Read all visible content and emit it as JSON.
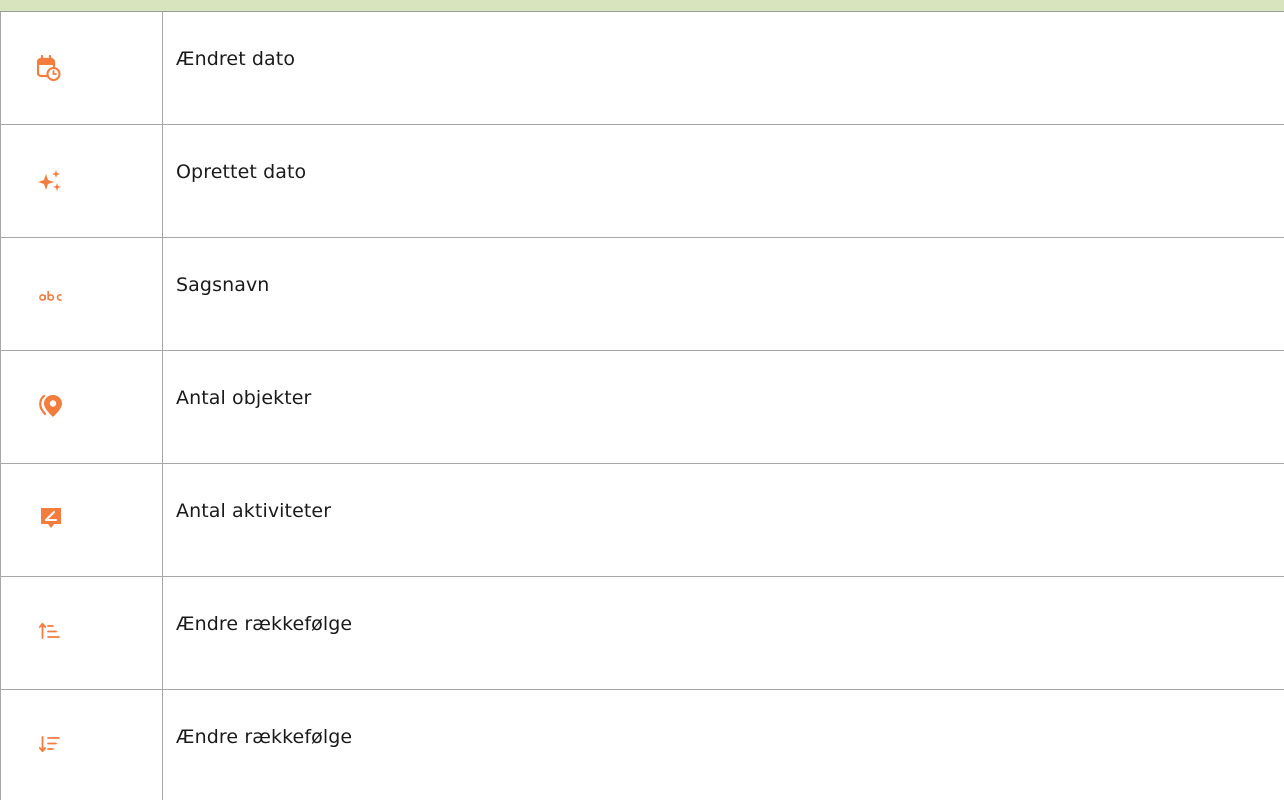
{
  "rows": [
    {
      "icon": "calendar-clock-icon",
      "label": "Ændret dato"
    },
    {
      "icon": "sparkles-icon",
      "label": "Oprettet dato"
    },
    {
      "icon": "text-abc-icon",
      "label": "Sagsnavn"
    },
    {
      "icon": "map-pin-icon",
      "label": "Antal objekter"
    },
    {
      "icon": "message-edit-icon",
      "label": "Antal aktiviteter"
    },
    {
      "icon": "sort-ascending-icon",
      "label": "Ændre rækkefølge"
    },
    {
      "icon": "sort-descending-icon",
      "label": "Ændre rækkefølge"
    }
  ],
  "colors": {
    "accent": "#f47c3c",
    "header_band": "#d7e4bd",
    "border": "#a6a6a6",
    "text": "#1a1a1a"
  }
}
